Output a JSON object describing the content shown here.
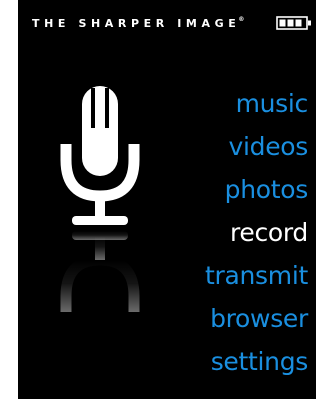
{
  "header": {
    "brand": "THE SHARPER IMAGE",
    "trademark": "®",
    "battery_icon": "battery-icon"
  },
  "main": {
    "feature_icon": "microphone-icon"
  },
  "menu": {
    "items": [
      {
        "label": "music"
      },
      {
        "label": "videos"
      },
      {
        "label": "photos"
      },
      {
        "label": "record",
        "selected": true
      },
      {
        "label": "transmit"
      },
      {
        "label": "browser"
      },
      {
        "label": "settings"
      }
    ]
  },
  "colors": {
    "background": "#000000",
    "menu_item": "#1a8fe0",
    "menu_item_selected": "#ffffff"
  }
}
